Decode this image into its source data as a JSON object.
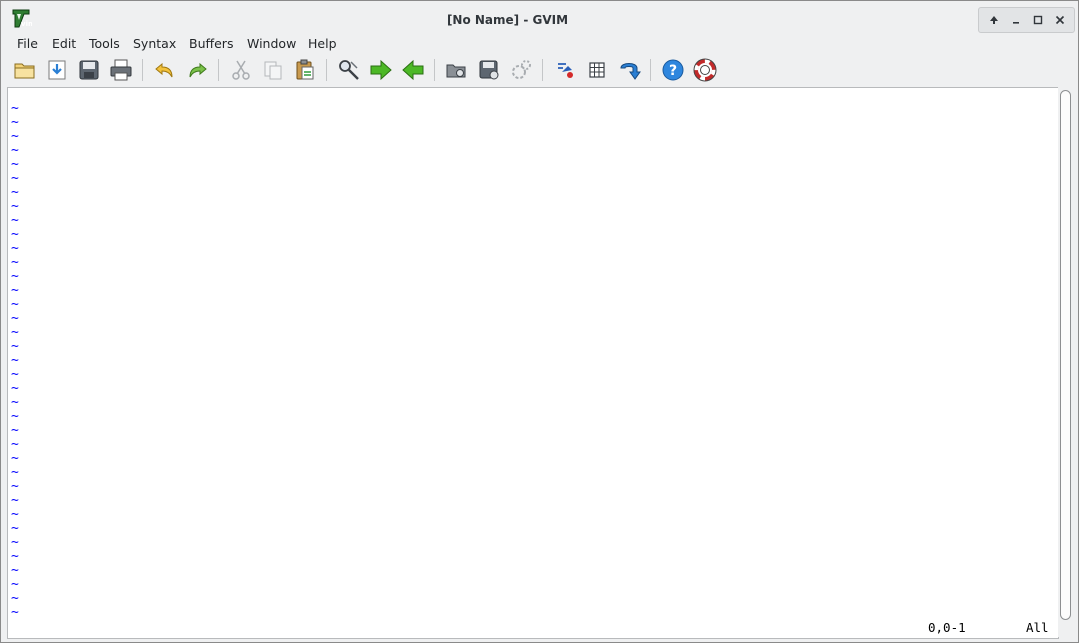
{
  "window": {
    "title": "[No Name] - GVIM"
  },
  "menu": [
    "File",
    "Edit",
    "Tools",
    "Syntax",
    "Buffers",
    "Window",
    "Help"
  ],
  "toolbar": {
    "icons": [
      "open-file-icon",
      "save-down-icon",
      "save-icon",
      "print-icon",
      "undo-icon",
      "redo-icon",
      "cut-icon",
      "copy-icon",
      "paste-icon",
      "find-replace-icon",
      "find-next-icon",
      "find-previous-icon",
      "load-session-icon",
      "save-session-icon",
      "run-script-icon",
      "make-icon",
      "tags-icon",
      "jump-tag-icon",
      "help-icon",
      "find-help-icon"
    ]
  },
  "editor": {
    "empty_line_marker": "~",
    "empty_line_count": 37,
    "text_color": "#0000ff"
  },
  "status": {
    "position": "0,0-1",
    "scroll": "All"
  }
}
